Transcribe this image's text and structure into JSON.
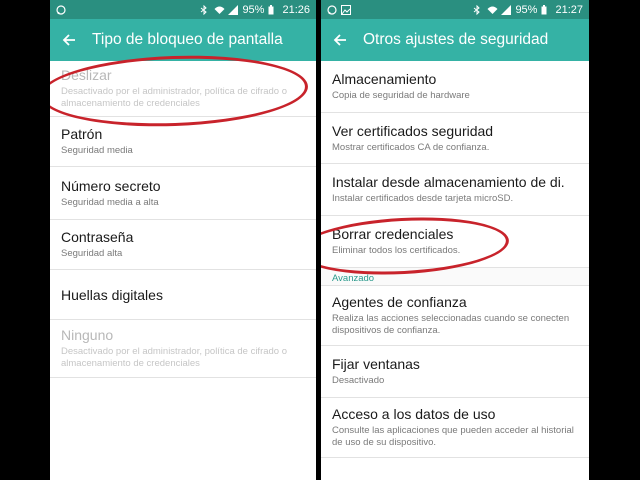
{
  "left": {
    "status": {
      "time": "21:26",
      "battery": "95%"
    },
    "title": "Tipo de bloqueo de pantalla",
    "items": [
      {
        "title": "Deslizar",
        "subtitle": "Desactivado por el administrador, política de cifrado o almacenamiento de credenciales",
        "disabled": true
      },
      {
        "title": "Patrón",
        "subtitle": "Seguridad media",
        "disabled": false
      },
      {
        "title": "Número secreto",
        "subtitle": "Seguridad media a alta",
        "disabled": false
      },
      {
        "title": "Contraseña",
        "subtitle": "Seguridad alta",
        "disabled": false
      },
      {
        "title": "Huellas digitales",
        "subtitle": "",
        "disabled": false
      },
      {
        "title": "Ninguno",
        "subtitle": "Desactivado por el administrador, política de cifrado o almacenamiento de credenciales",
        "disabled": true
      }
    ]
  },
  "right": {
    "status": {
      "time": "21:27",
      "battery": "95%"
    },
    "title": "Otros ajustes de seguridad",
    "items": [
      {
        "title": "Almacenamiento",
        "subtitle": "Copia de seguridad de hardware"
      },
      {
        "title": "Ver certificados seguridad",
        "subtitle": "Mostrar certificados CA de confianza."
      },
      {
        "title": "Instalar desde almacenamiento de di.",
        "subtitle": "Instalar certificados desde tarjeta microSD."
      },
      {
        "title": "Borrar credenciales",
        "subtitle": "Eliminar todos los certificados."
      }
    ],
    "section": "Avanzado",
    "advanced": [
      {
        "title": "Agentes de confianza",
        "subtitle": "Realiza las acciones seleccionadas cuando se conecten dispositivos de confianza."
      },
      {
        "title": "Fijar ventanas",
        "subtitle": "Desactivado"
      },
      {
        "title": "Acceso a los datos de uso",
        "subtitle": "Consulte las aplicaciones que pueden acceder al historial de uso de su dispositivo."
      }
    ]
  },
  "colors": {
    "statusbar": "#2a8f80",
    "appbar": "#35b2a5",
    "annotation": "#c8232b",
    "section": "#2a9a8c"
  }
}
